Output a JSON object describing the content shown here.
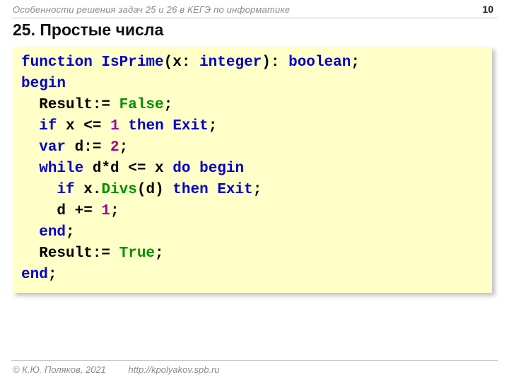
{
  "header": "Особенности решения задач 25 и 26 в КЕГЭ по информатике",
  "page_number": "10",
  "title": "25. Простые числа",
  "code": {
    "l1": {
      "a": "function ",
      "b": "IsPrime",
      "c": "(x: ",
      "d": "integer",
      "e": "): ",
      "f": "boolean",
      "g": ";"
    },
    "l2": "begin",
    "l3": {
      "a": "  Result:= ",
      "b": "False",
      "c": ";"
    },
    "l4": {
      "a": "  ",
      "b": "if",
      "c": " x <= ",
      "d": "1",
      "e": " ",
      "f": "then",
      "g": " ",
      "h": "Exit",
      "i": ";"
    },
    "l5": {
      "a": "  ",
      "b": "var",
      "c": " d:= ",
      "d": "2",
      "e": ";"
    },
    "l6": {
      "a": "  ",
      "b": "while",
      "c": " d*d <= x ",
      "d": "do",
      "e": " ",
      "f": "begin"
    },
    "l7": {
      "a": "    ",
      "b": "if",
      "c": " x.",
      "d": "Divs",
      "e": "(d) ",
      "f": "then",
      "g": " ",
      "h": "Exit",
      "i": ";"
    },
    "l8": {
      "a": "    d += ",
      "b": "1",
      "c": ";"
    },
    "l9": {
      "a": "  ",
      "b": "end",
      "c": ";"
    },
    "l10": {
      "a": "  Result:= ",
      "b": "True",
      "c": ";"
    },
    "l11": {
      "a": "end",
      "b": ";"
    }
  },
  "footer": {
    "copyright": "© К.Ю. Поляков, 2021",
    "url": "http://kpolyakov.spb.ru"
  }
}
